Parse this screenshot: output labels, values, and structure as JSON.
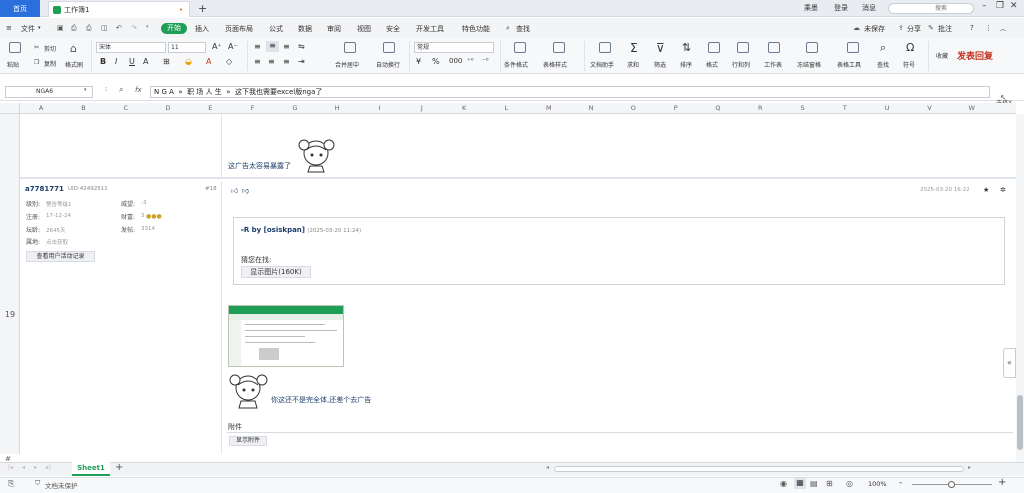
{
  "tabbar": {
    "home": "首页",
    "doc_title": "工作簿1",
    "close": "•",
    "add": "+",
    "right_items": [
      "乘墨",
      "登录",
      "消息"
    ],
    "search": "搜索"
  },
  "menu": {
    "file": "文件",
    "items": [
      "开始",
      "插入",
      "页面布局",
      "公式",
      "数据",
      "审阅",
      "视图",
      "安全",
      "开发工具",
      "特色功能"
    ],
    "find": "查找",
    "unsaved": "未保存",
    "share": "分享",
    "annotate": "批注",
    "help": "?"
  },
  "ribbon": {
    "paste": "粘贴",
    "cut": "剪切",
    "copy": "复制",
    "format_painter": "格式刷",
    "font_name": "宋体",
    "font_size": "11",
    "number_format": "常规",
    "merge": "合并居中",
    "wrap": "自动换行",
    "cond_format": "条件格式",
    "table_style": "表格样式",
    "doc_helper": "文档助手",
    "sum": "求和",
    "filter": "筛选",
    "sort": "排序",
    "format": "格式",
    "row_col": "行和列",
    "worksheet": "工作表",
    "freeze": "冻结窗格",
    "table_tools": "表格工具",
    "find": "查找",
    "symbol": "符号",
    "favorite": "收藏",
    "publish": "发表回复"
  },
  "formula": {
    "cell": "NGA6",
    "fx": "fx",
    "content": "N G A  »  职 场 人 生  »  这下我也需要excel版nga了",
    "select_label": "选择X"
  },
  "columns": [
    "A",
    "B",
    "C",
    "D",
    "E",
    "F",
    "G",
    "H",
    "I",
    "J",
    "K",
    "L",
    "M",
    "N",
    "O",
    "P",
    "Q",
    "R",
    "S",
    "T",
    "U",
    "V",
    "W"
  ],
  "rows": {
    "row19": "19",
    "hash": "#"
  },
  "post_prev": {
    "text": "这广告太容易暴露了"
  },
  "post": {
    "author": "a7781771",
    "uid": "UID:42492511",
    "floor": "#18",
    "level_label": "级别:",
    "level_value": "警告等级1",
    "prestige_label": "威望:",
    "prestige_value": "-3",
    "reg_label": "注册:",
    "reg_value": "17-12-24",
    "wealth_label": "财富:",
    "wealth_value": "3",
    "age_label": "坛龄:",
    "age_value": "2645天",
    "posts_label": "发帖:",
    "posts_value": "3314",
    "loc_label": "属地:",
    "loc_value": "点击获取",
    "activity_btn": "查看用户活动记录",
    "timestamp": "2025-03-20 16:22",
    "quote_prefix": "R by ",
    "quote_user": "[osiskpan]",
    "quote_time": "(2025-03-20 11:24)",
    "quote_body": "猜您在找:",
    "show_image": "显示图片(160K)",
    "reply_text": "你这还不是完全体,还差个去广告",
    "attachment_label": "附件",
    "show_attachment": "显示附件"
  },
  "sheet": {
    "tab": "Sheet1",
    "add": "+"
  },
  "status": {
    "protect": "文档未保护",
    "zoom": "100%",
    "minus": "-",
    "plus": "+"
  },
  "colors": {
    "accent": "#1f9e57",
    "home_tab": "#2a6fdb",
    "publish": "#c3331c",
    "author": "#1b3d6b"
  }
}
